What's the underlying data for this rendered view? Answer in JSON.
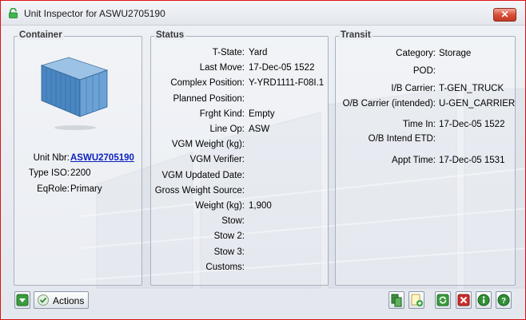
{
  "window": {
    "title": "Unit Inspector for ASWU2705190"
  },
  "container": {
    "title": "Container",
    "fields": [
      {
        "label": "Unit Nbr:",
        "value": "ASWU2705190"
      },
      {
        "label": "Type ISO:",
        "value": "2200"
      },
      {
        "label": "EqRole:",
        "value": "Primary"
      }
    ]
  },
  "status": {
    "title": "Status",
    "fields": [
      {
        "label": "T-State:",
        "value": "Yard"
      },
      {
        "label": "Last Move:",
        "value": "17-Dec-05 1522"
      },
      {
        "label": "Complex Position:",
        "value": "Y-YRD1111-F08I.1"
      },
      {
        "label": "Planned Position:",
        "value": ""
      },
      {
        "label": "Frght Kind:",
        "value": "Empty"
      },
      {
        "label": "Line Op:",
        "value": "ASW"
      },
      {
        "label": "VGM Weight (kg):",
        "value": ""
      },
      {
        "label": "VGM Verifier:",
        "value": ""
      },
      {
        "label": "VGM Updated Date:",
        "value": ""
      },
      {
        "label": "Gross Weight Source:",
        "value": ""
      },
      {
        "label": "Weight (kg):",
        "value": "1,900"
      },
      {
        "label": "Stow:",
        "value": ""
      },
      {
        "label": "Stow 2:",
        "value": ""
      },
      {
        "label": "Stow 3:",
        "value": ""
      },
      {
        "label": "Customs:",
        "value": ""
      }
    ]
  },
  "transit": {
    "title": "Transit",
    "fields": [
      {
        "label": "Category:",
        "value": "Storage"
      },
      {
        "label": "POD:",
        "value": ""
      },
      {
        "label": "I/B Carrier:",
        "value": "T-GEN_TRUCK"
      },
      {
        "label": "O/B Carrier (intended):",
        "value": "U-GEN_CARRIER"
      },
      {
        "label": "Time In:",
        "value": "17-Dec-05 1522"
      },
      {
        "label": "O/B Intend ETD:",
        "value": ""
      },
      {
        "label": "Appt Time:",
        "value": "17-Dec-05 1531"
      }
    ]
  },
  "footer": {
    "actions_label": "Actions",
    "icons": [
      "expand-icon",
      "check-icon",
      "copy-icon",
      "add-note-icon",
      "refresh-icon",
      "delete-icon",
      "info-icon",
      "help-icon"
    ]
  }
}
